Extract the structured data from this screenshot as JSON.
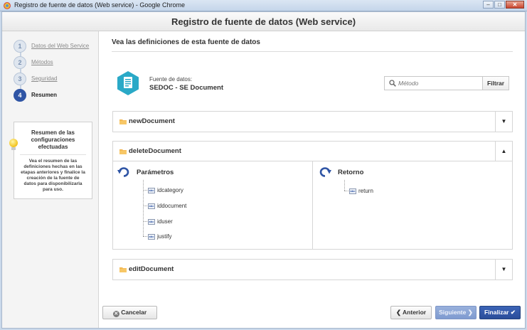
{
  "window": {
    "title": "Registro de fuente de datos (Web service) - Google Chrome"
  },
  "dialog": {
    "title": "Registro de fuente de datos (Web service)"
  },
  "steps": [
    {
      "num": "1",
      "label": "Datos del Web Service"
    },
    {
      "num": "2",
      "label": "Métodos"
    },
    {
      "num": "3",
      "label": "Seguridad"
    },
    {
      "num": "4",
      "label": "Resumen"
    }
  ],
  "summary": {
    "title": "Resumen de las configuraciones efectuadas",
    "description": "Vea el resumen de las definiciones hechas en las etapas anteriores y finalice la creación de la fuente de datos para disponibilizarla para uso."
  },
  "main": {
    "section_title": "Vea las definiciones de esta fuente de datos",
    "source_label": "Fuente de datos:",
    "source_value": "SEDOC - SE Document",
    "search_placeholder": "Método",
    "filter_label": "Filtrar"
  },
  "methods": [
    {
      "name": "newDocument",
      "toggle": "▼"
    },
    {
      "name": "deleteDocument",
      "toggle": "▲",
      "params_title": "Parámetros",
      "params": [
        "idcategory",
        "iddocument",
        "iduser",
        "justify"
      ],
      "return_title": "Retorno",
      "returns": [
        "return"
      ]
    },
    {
      "name": "editDocument",
      "toggle": "▼"
    }
  ],
  "field_icon_text": "abc",
  "footer": {
    "cancel": "Cancelar",
    "previous": "Anterior",
    "next": "Siguiente",
    "finish": "Finalizar"
  },
  "icons": {
    "folder": "folder-icon",
    "search": "search-icon",
    "source": "datasource-icon",
    "params": "undo-arrow-icon",
    "return": "redo-arrow-icon",
    "bulb": "lightbulb-icon"
  },
  "colors": {
    "accent": "#2f55a5",
    "teal": "#2aa9c7",
    "folder": "#f0b24a"
  }
}
